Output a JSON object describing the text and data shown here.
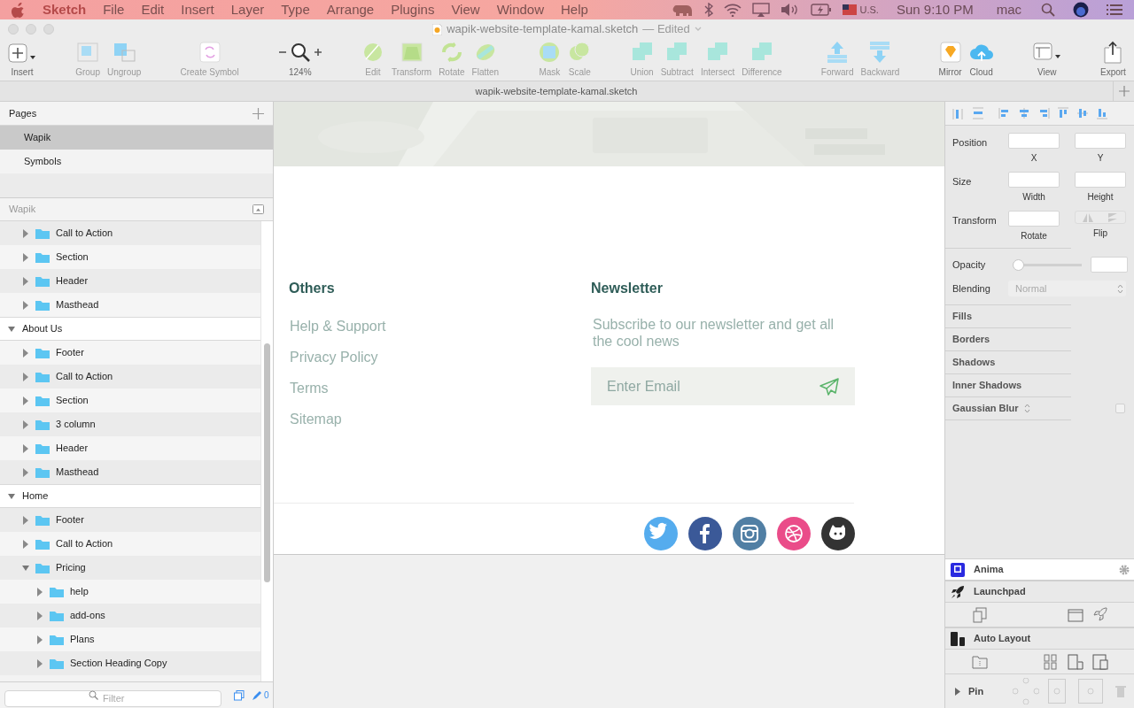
{
  "menu_bar": {
    "app": "Sketch",
    "items": [
      "File",
      "Edit",
      "Insert",
      "Layer",
      "Type",
      "Arrange",
      "Plugins",
      "View",
      "Window",
      "Help"
    ],
    "status": {
      "input": "U.S.",
      "clock": "Sun 9:10 PM",
      "user": "mac"
    }
  },
  "window": {
    "title": "wapik-website-template-kamal.sketch",
    "edited": "— Edited"
  },
  "toolbar": [
    [
      {
        "label": "Insert",
        "kind": "insert",
        "disabled": false
      }
    ],
    [
      {
        "label": "Group",
        "kind": "group",
        "disabled": true
      },
      {
        "label": "Ungroup",
        "kind": "ungroup",
        "disabled": true
      }
    ],
    [
      {
        "label": "Create Symbol",
        "kind": "symbol",
        "disabled": true
      }
    ],
    [
      {
        "label": "124%",
        "kind": "zoom",
        "disabled": false
      }
    ],
    [
      {
        "label": "Edit",
        "kind": "edit",
        "disabled": true
      },
      {
        "label": "Transform",
        "kind": "transform",
        "disabled": true
      },
      {
        "label": "Rotate",
        "kind": "rotate",
        "disabled": true
      },
      {
        "label": "Flatten",
        "kind": "flatten",
        "disabled": true
      }
    ],
    [
      {
        "label": "Mask",
        "kind": "mask",
        "disabled": true
      },
      {
        "label": "Scale",
        "kind": "scale",
        "disabled": true
      }
    ],
    [
      {
        "label": "Union",
        "kind": "boolean",
        "disabled": true
      },
      {
        "label": "Subtract",
        "kind": "boolean",
        "disabled": true
      },
      {
        "label": "Intersect",
        "kind": "boolean",
        "disabled": true
      },
      {
        "label": "Difference",
        "kind": "boolean",
        "disabled": true
      }
    ],
    [
      {
        "label": "Forward",
        "kind": "forward",
        "disabled": true
      },
      {
        "label": "Backward",
        "kind": "backward",
        "disabled": true
      }
    ],
    [
      {
        "label": "Mirror",
        "kind": "mirror",
        "disabled": false
      },
      {
        "label": "Cloud",
        "kind": "cloud",
        "disabled": false
      }
    ],
    [
      {
        "label": "View",
        "kind": "view",
        "disabled": false
      }
    ],
    [
      {
        "label": "Export",
        "kind": "export",
        "disabled": false
      }
    ]
  ],
  "tab": {
    "title": "wapik-website-template-kamal.sketch"
  },
  "pages": {
    "title": "Pages",
    "items": [
      {
        "name": "Wapik",
        "selected": true
      },
      {
        "name": "Symbols",
        "selected": false
      }
    ]
  },
  "layers": {
    "title": "Wapik",
    "items": [
      {
        "children": [
          {
            "name": "Call to Action",
            "kind": "group",
            "expanded": false
          },
          {
            "name": "Section",
            "kind": "group",
            "expanded": false
          },
          {
            "name": "Header",
            "kind": "group",
            "expanded": false
          },
          {
            "name": "Masthead",
            "kind": "group",
            "expanded": false
          }
        ]
      },
      {
        "name": "About Us",
        "kind": "artboard",
        "expanded": true,
        "children": [
          {
            "name": "Footer",
            "kind": "group",
            "expanded": false
          },
          {
            "name": "Call to Action",
            "kind": "group",
            "expanded": false
          },
          {
            "name": "Section",
            "kind": "group",
            "expanded": false
          },
          {
            "name": "3 column",
            "kind": "group",
            "expanded": false
          },
          {
            "name": "Header",
            "kind": "group",
            "expanded": false
          },
          {
            "name": "Masthead",
            "kind": "group",
            "expanded": false
          }
        ]
      },
      {
        "name": "Home",
        "kind": "artboard",
        "expanded": true,
        "children": [
          {
            "name": "Footer",
            "kind": "group",
            "expanded": false
          },
          {
            "name": "Call to Action",
            "kind": "group",
            "expanded": false
          },
          {
            "name": "Pricing",
            "kind": "group",
            "expanded": true,
            "children": [
              {
                "name": "help",
                "kind": "group",
                "expanded": false
              },
              {
                "name": "add-ons",
                "kind": "group",
                "expanded": false
              },
              {
                "name": "Plans",
                "kind": "group",
                "expanded": false
              },
              {
                "name": "Section Heading Copy",
                "kind": "group",
                "expanded": false
              }
            ]
          }
        ]
      }
    ]
  },
  "filter": {
    "placeholder": "Filter",
    "count": "0"
  },
  "artboard": {
    "others": {
      "title": "Others",
      "links": [
        "Help & Support",
        "Privacy Policy",
        "Terms",
        "Sitemap"
      ]
    },
    "newsletter": {
      "title": "Newsletter",
      "text": "Subscribe to our newsletter and get all the cool news",
      "placeholder": "Enter Email"
    },
    "social": [
      {
        "kind": "twitter",
        "color": "#55acee"
      },
      {
        "kind": "facebook",
        "color": "#3b5998"
      },
      {
        "kind": "instagram",
        "color": "#517fa4"
      },
      {
        "kind": "dribbble",
        "color": "#ea4c89"
      },
      {
        "kind": "github",
        "color": "#333333"
      }
    ]
  },
  "inspector": {
    "position": {
      "label": "Position",
      "x": "X",
      "y": "Y"
    },
    "size": {
      "label": "Size",
      "width": "Width",
      "height": "Height"
    },
    "transform": {
      "label": "Transform",
      "rotate": "Rotate",
      "flip": "Flip"
    },
    "opacity": {
      "label": "Opacity",
      "level": 0
    },
    "blending": {
      "label": "Blending",
      "value": "Normal"
    },
    "sections": [
      {
        "title": "Fills",
        "kind": "plain"
      },
      {
        "title": "Borders",
        "kind": "plain"
      },
      {
        "title": "Shadows",
        "kind": "plain"
      },
      {
        "title": "Inner Shadows",
        "kind": "plain"
      },
      {
        "title": "Gaussian Blur",
        "kind": "blur",
        "checked": false
      }
    ],
    "plugins": [
      {
        "title": "Anima",
        "kind": "anima",
        "selected": true
      },
      {
        "title": "Launchpad",
        "kind": "launchpad",
        "selected": false
      },
      {
        "title": "Auto Layout",
        "kind": "autolayout",
        "selected": false
      }
    ],
    "pin": {
      "label": "Pin",
      "expanded": false
    }
  }
}
